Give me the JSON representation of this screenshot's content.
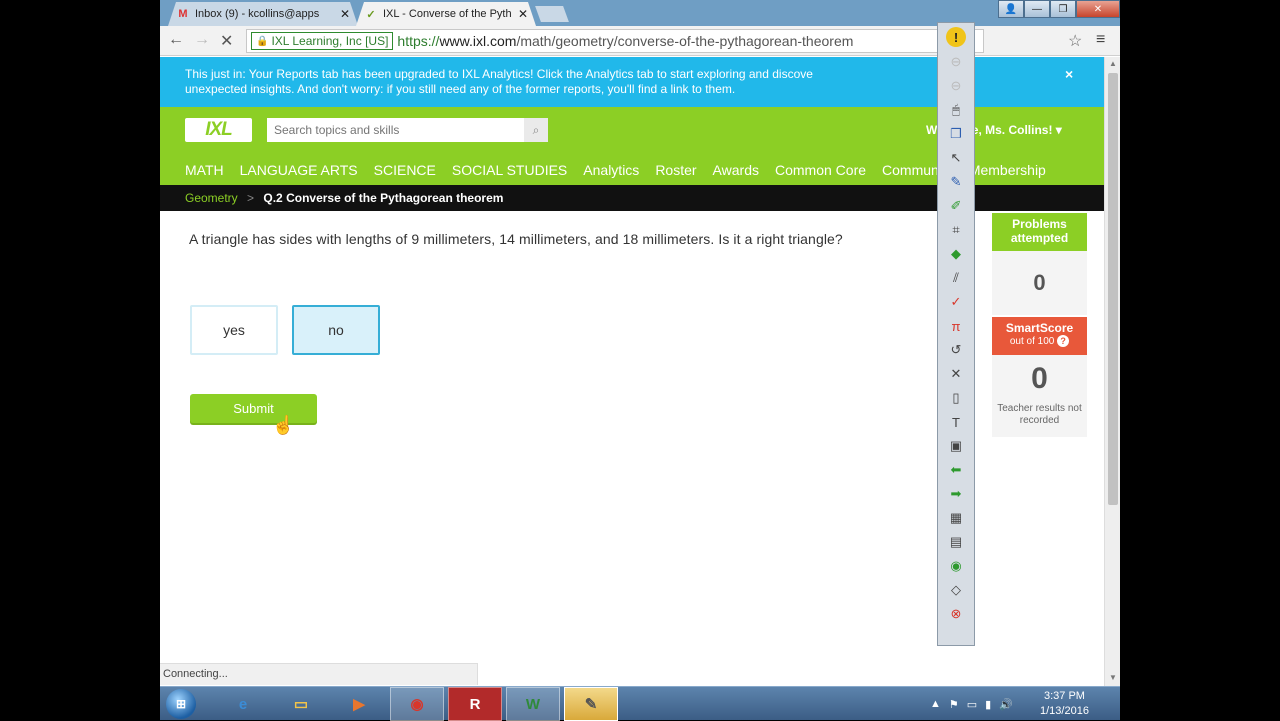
{
  "browser": {
    "tabs": [
      {
        "label": "Inbox (9) - kcollins@apps",
        "favicon": "M"
      },
      {
        "label": "IXL - Converse of the Pyth",
        "favicon": "✓"
      }
    ],
    "close_glyph": "✕",
    "secure_label": "IXL Learning, Inc [US]",
    "url_scheme": "https://",
    "url_host": "www.ixl.com",
    "url_path": "/math/geometry/converse-of-the-pythagorean-theorem",
    "status_text": "Connecting..."
  },
  "banner": {
    "line1": "This just in: Your Reports tab has been upgraded to IXL Analytics! Click the Analytics tab to start exploring and discove",
    "line2": "unexpected insights. And don't worry: if you still need any of the former reports, you'll find a link to them.",
    "close": "×"
  },
  "header": {
    "logo": "IXL",
    "search_placeholder": "Search topics and skills",
    "welcome": "Welcome, Ms. Collins! ▾",
    "nav": [
      "MATH",
      "LANGUAGE ARTS",
      "SCIENCE",
      "SOCIAL STUDIES",
      "Analytics",
      "Roster",
      "Awards",
      "Common Core",
      "Community",
      "Membership"
    ]
  },
  "breadcrumb": {
    "parent": "Geometry",
    "separator": ">",
    "current": "Q.2 Converse of the Pythagorean theorem"
  },
  "question": {
    "text": "A triangle has sides with lengths of 9 millimeters, 14 millimeters, and 18 millimeters. Is it a right triangle?",
    "answers": [
      "yes",
      "no"
    ],
    "selected": "no",
    "submit": "Submit"
  },
  "stats": {
    "problems_label": "Problems attempted",
    "problems_value": "0",
    "smartscore_label": "SmartScore",
    "smartscore_sub": "out of 100",
    "smartscore_help": "?",
    "smartscore_value": "0",
    "note": "Teacher results not recorded"
  },
  "taskbar": {
    "start": "⊞",
    "clock_time": "3:37 PM",
    "clock_date": "1/13/2016"
  },
  "colors": {
    "ixl_green": "#8ccf25",
    "banner_blue": "#21b8ea",
    "selected_answer": "#d9f1fa",
    "smartscore_red": "#e8583a"
  }
}
